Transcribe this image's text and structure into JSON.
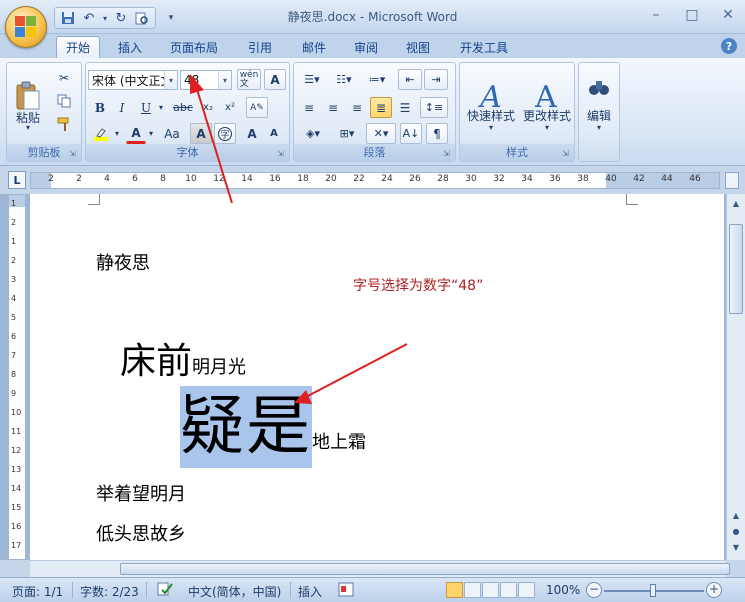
{
  "window": {
    "title": "静夜思.docx - Microsoft Word",
    "controls": {
      "minimize": "–",
      "maximize": "□",
      "close": "✕"
    }
  },
  "quick_access": {
    "save_icon": "save-icon",
    "undo_icon": "undo-icon",
    "redo_icon": "redo-icon",
    "print_preview_icon": "print-preview-icon"
  },
  "tabs": [
    {
      "label": "开始",
      "active": true
    },
    {
      "label": "插入"
    },
    {
      "label": "页面布局"
    },
    {
      "label": "引用"
    },
    {
      "label": "邮件"
    },
    {
      "label": "审阅"
    },
    {
      "label": "视图"
    },
    {
      "label": "开发工具"
    }
  ],
  "ribbon": {
    "clipboard": {
      "label": "剪贴板",
      "paste_label": "粘贴"
    },
    "font": {
      "label": "字体",
      "font_name": "宋体 (中文正文",
      "font_size": "48",
      "bold": "B",
      "italic": "I",
      "underline": "U",
      "strike": "abc",
      "grow": "A",
      "shrink": "A",
      "change_case": "Aa"
    },
    "paragraph": {
      "label": "段落"
    },
    "styles": {
      "label": "样式",
      "quick_styles": "快速样式",
      "change_styles": "更改样式"
    },
    "editing": {
      "label": "编辑"
    }
  },
  "ruler": {
    "ticks": [
      "2",
      "2",
      "4",
      "6",
      "8",
      "10",
      "12",
      "14",
      "16",
      "18",
      "20",
      "22",
      "24",
      "26",
      "28",
      "30",
      "32",
      "34",
      "36",
      "38",
      "40",
      "42",
      "44",
      "46"
    ],
    "vticks": [
      "1",
      "2",
      "1",
      "2",
      "3",
      "4",
      "5",
      "6",
      "7",
      "8",
      "9",
      "10",
      "11",
      "12",
      "13",
      "14",
      "15",
      "16",
      "17"
    ]
  },
  "document": {
    "title_line": "静夜思",
    "line1_big": "床前",
    "line1_rest": "明月光",
    "line2_big": "疑是",
    "line2_rest": "地上霜",
    "line3": "举着望明月",
    "line4": "低头思故乡",
    "annotation": "字号选择为数字“48”"
  },
  "status": {
    "page": "页面: 1/1",
    "words": "字数: 2/23",
    "language": "中文(简体，中国)",
    "insert_mode": "插入",
    "zoom": "100%"
  },
  "colors": {
    "accent": "#1e395b",
    "selection": "#a9c5ec",
    "annotation": "#b02020",
    "arrow": "#e02020"
  }
}
